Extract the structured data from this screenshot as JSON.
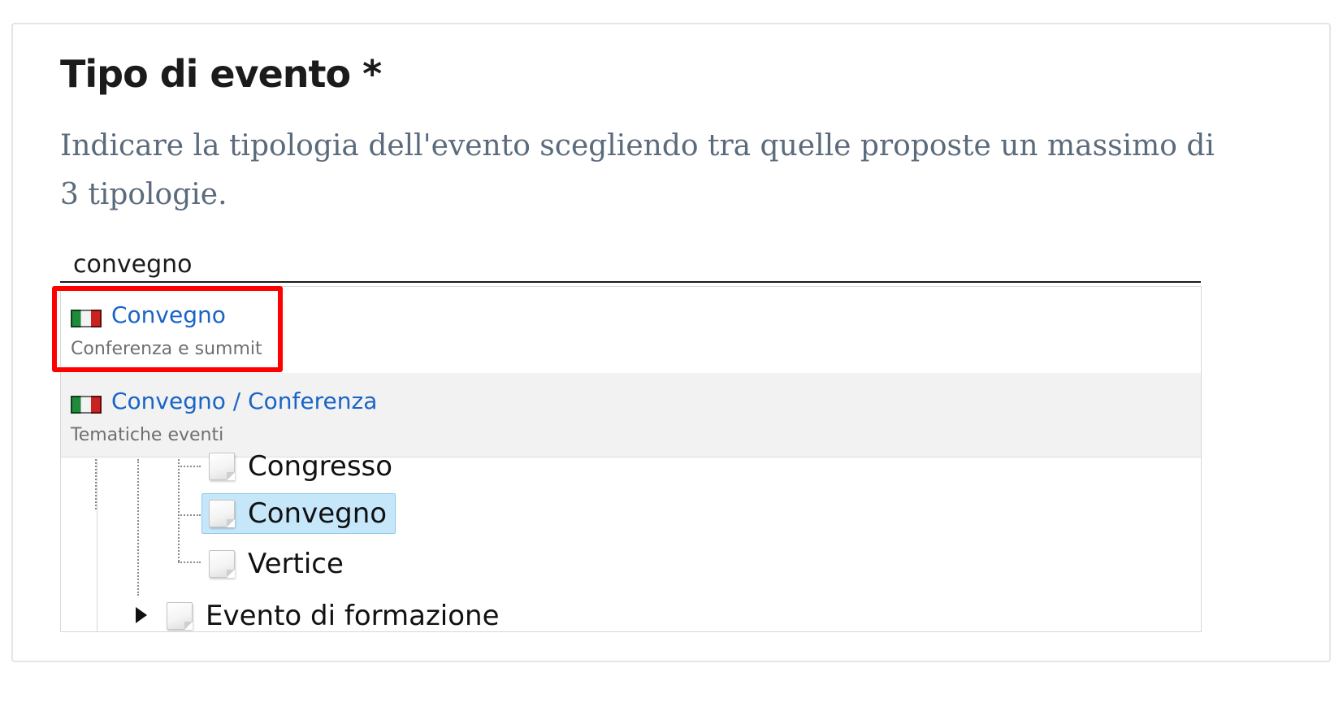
{
  "field": {
    "title": "Tipo di evento *",
    "description": "Indicare la tipologia dell'evento scegliendo tra quelle proposte un massimo di 3 tipologie."
  },
  "search": {
    "value": "convegno"
  },
  "results": [
    {
      "label": "Convegno",
      "subtitle": "Conferenza e summit",
      "icon": "italian-flag-icon"
    },
    {
      "label": "Convegno / Conferenza",
      "subtitle": "Tematiche eventi",
      "icon": "italian-flag-icon"
    }
  ],
  "tree": {
    "nodes": [
      {
        "label": "Congresso",
        "selected": false
      },
      {
        "label": "Convegno",
        "selected": true
      },
      {
        "label": "Vertice",
        "selected": false
      },
      {
        "label": "Evento di formazione",
        "selected": false,
        "collapsed": true
      }
    ]
  },
  "colors": {
    "highlight": "#ff0000",
    "link": "#1a64c8",
    "selected_bg": "#c6e7fa"
  }
}
